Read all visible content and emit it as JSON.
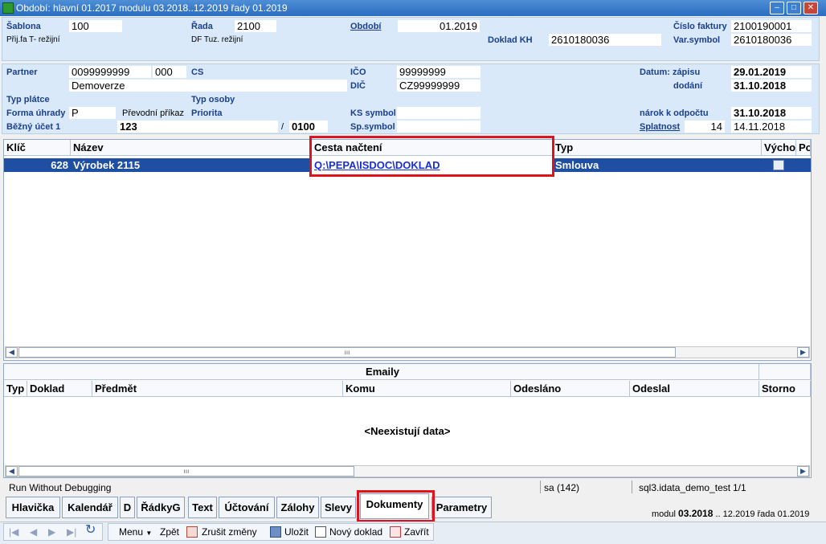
{
  "window": {
    "title": "Období: hlavní 01.2017 modulu 03.2018..12.2019 řady 01.2019",
    "minimize": "‒",
    "maximize": "□",
    "close": "✕"
  },
  "header1": {
    "sablona_label": "Šablona",
    "sablona_value": "100",
    "sablona_desc": "Přij.fa T- režijní",
    "rada_label": "Řada",
    "rada_value": "2100",
    "rada_desc": "DF Tuz. režijní",
    "obdobi_label": "Období",
    "obdobi_value": "01.2019",
    "doklad_kh_label": "Doklad KH",
    "doklad_kh_value": "2610180036",
    "cislo_faktury_label": "Číslo faktury",
    "cislo_faktury_value": "2100190001",
    "var_symbol_label": "Var.symbol",
    "var_symbol_value": "2610180036"
  },
  "header2": {
    "partner_label": "Partner",
    "partner_value": "0099999999",
    "partner_code": "000",
    "cs_label": "CS",
    "partner_name": "Demoverze",
    "typ_platce_label": "Typ plátce",
    "typ_osoby_label": "Typ osoby",
    "forma_uhrady_label": "Forma úhrady",
    "forma_uhrady_value": "P",
    "forma_uhrady_desc": "Převodní příkaz",
    "priorita_label": "Priorita",
    "bezny_ucet_label": "Běžný účet 1",
    "bezny_ucet_value": "123",
    "bank_sep": "/",
    "bank_code": "0100",
    "ico_label": "IČO",
    "ico_value": "99999999",
    "dic_label": "DIČ",
    "dic_value": "CZ99999999",
    "ks_label": "KS symbol",
    "sp_label": "Sp.symbol",
    "datum_zapisu_label": "Datum: zápisu",
    "datum_zapisu_value": "29.01.2019",
    "dodani_label": "dodání",
    "dodani_value": "31.10.2018",
    "narok_label": "nárok k odpočtu",
    "narok_value": "31.10.2018",
    "splatnost_label": "Splatnost",
    "splatnost_days": "14",
    "splatnost_value": "14.11.2018"
  },
  "documents": {
    "columns": [
      "Klíč",
      "Název",
      "Cesta načtení",
      "Typ",
      "Výcho",
      "Po"
    ],
    "rows": [
      {
        "klic": "628",
        "nazev": "Výrobek 2115",
        "cesta": "Q:\\PEPA\\ISDOC\\DOKLAD",
        "typ": "Smlouva"
      }
    ],
    "scroll_grip": "ııı"
  },
  "emaily": {
    "title": "Emaily",
    "columns": [
      "Typ",
      "Doklad",
      "Předmět",
      "Komu",
      "Odesláno",
      "Odeslal",
      "Storno"
    ],
    "empty": "<Neexistují data>",
    "scroll_grip": "ııı"
  },
  "status": {
    "mode": "Run Without Debugging",
    "user": "sa (142)",
    "db": "sql3.idata_demo_test",
    "page": "1/1"
  },
  "tabs": [
    "Hlavička",
    "Kalendář",
    "D",
    "ŘádkyG",
    "Text",
    "Účtování",
    "Zálohy",
    "Slevy",
    "Dokumenty",
    "Parametry"
  ],
  "active_tab": "Dokumenty",
  "module_info": {
    "modul_label": "modul",
    "modul_value": "03.2018",
    "range_sep": "..",
    "range_end": "12.2019",
    "rada_label": "řada",
    "rada_value": "01.2019"
  },
  "toolbar": {
    "menu": "Menu",
    "back": "Zpět",
    "cancel": "Zrušit změny",
    "save": "Uložit",
    "new": "Nový doklad",
    "close": "Zavřít"
  },
  "nav": {
    "first": "|◀",
    "prev": "◀",
    "next": "▶",
    "last": "▶|",
    "refresh": "↻"
  },
  "colors": {
    "selected_row": "#1e4fa2",
    "highlight": "#e0121b",
    "panel": "#d9e9f9",
    "label": "#1a3f8f"
  }
}
